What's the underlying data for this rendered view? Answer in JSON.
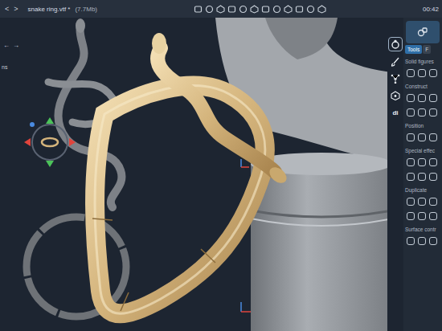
{
  "topbar": {
    "nav": [
      "<",
      ">"
    ],
    "title": "snake ring.vtf *",
    "size": "(7.7Mb)",
    "time": "00:42"
  },
  "viewport": {
    "nav": [
      "←",
      "→"
    ],
    "side_label": "ns"
  },
  "tools": [
    {
      "kind": "ring",
      "selected": true
    },
    {
      "kind": "brush",
      "selected": false
    },
    {
      "kind": "graph",
      "selected": false
    },
    {
      "kind": "nodes",
      "selected": false
    },
    {
      "kind": "text",
      "label": "di",
      "selected": false
    }
  ],
  "panel": {
    "tabs": [
      {
        "label": "Tools",
        "selected": true
      },
      {
        "label": "F",
        "selected": false
      }
    ],
    "sections": [
      "Solid figures",
      "Construct",
      "Position",
      "Special effec",
      "Duplicate",
      "Surface contr"
    ]
  }
}
